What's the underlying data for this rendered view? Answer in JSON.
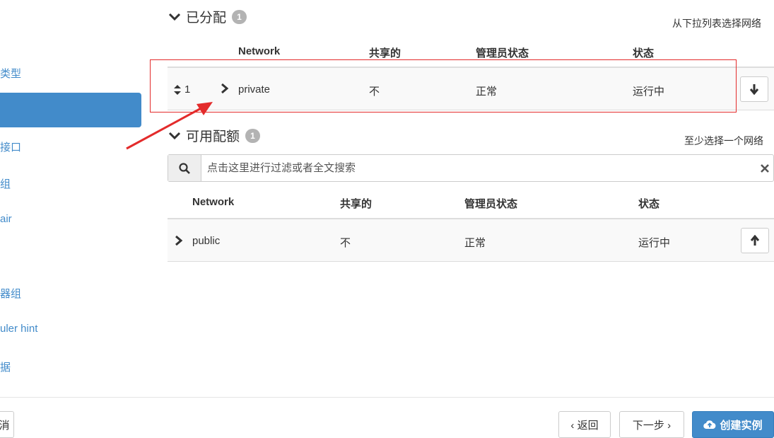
{
  "sidebar": {
    "items": [
      {
        "label": "类型"
      },
      {
        "label": ""
      },
      {
        "label": "接口"
      },
      {
        "label": "组"
      },
      {
        "label": "air"
      },
      {
        "label": "器组"
      },
      {
        "label": "uler hint"
      },
      {
        "label": "据"
      }
    ]
  },
  "allocated": {
    "title": "已分配",
    "count": "1",
    "hint": "从下拉列表选择网络",
    "columns": [
      "Network",
      "共享的",
      "管理员状态",
      "状态"
    ],
    "rows": [
      {
        "order": "1",
        "network": "private",
        "shared": "不",
        "admin_state": "正常",
        "status": "运行中"
      }
    ]
  },
  "available": {
    "title": "可用配额",
    "count": "1",
    "hint": "至少选择一个网络",
    "search_placeholder": "点击这里进行过滤或者全文搜索",
    "columns": [
      "Network",
      "共享的",
      "管理员状态",
      "状态"
    ],
    "rows": [
      {
        "network": "public",
        "shared": "不",
        "admin_state": "正常",
        "status": "运行中"
      }
    ]
  },
  "footer": {
    "cancel_label": "消",
    "back_label": "‹ 返回",
    "next_label": "下一步 ›",
    "create_label": "创建实例"
  },
  "colors": {
    "accent": "#428bca",
    "annotation": "#e32b2b",
    "badge": "#b3b3b3"
  }
}
